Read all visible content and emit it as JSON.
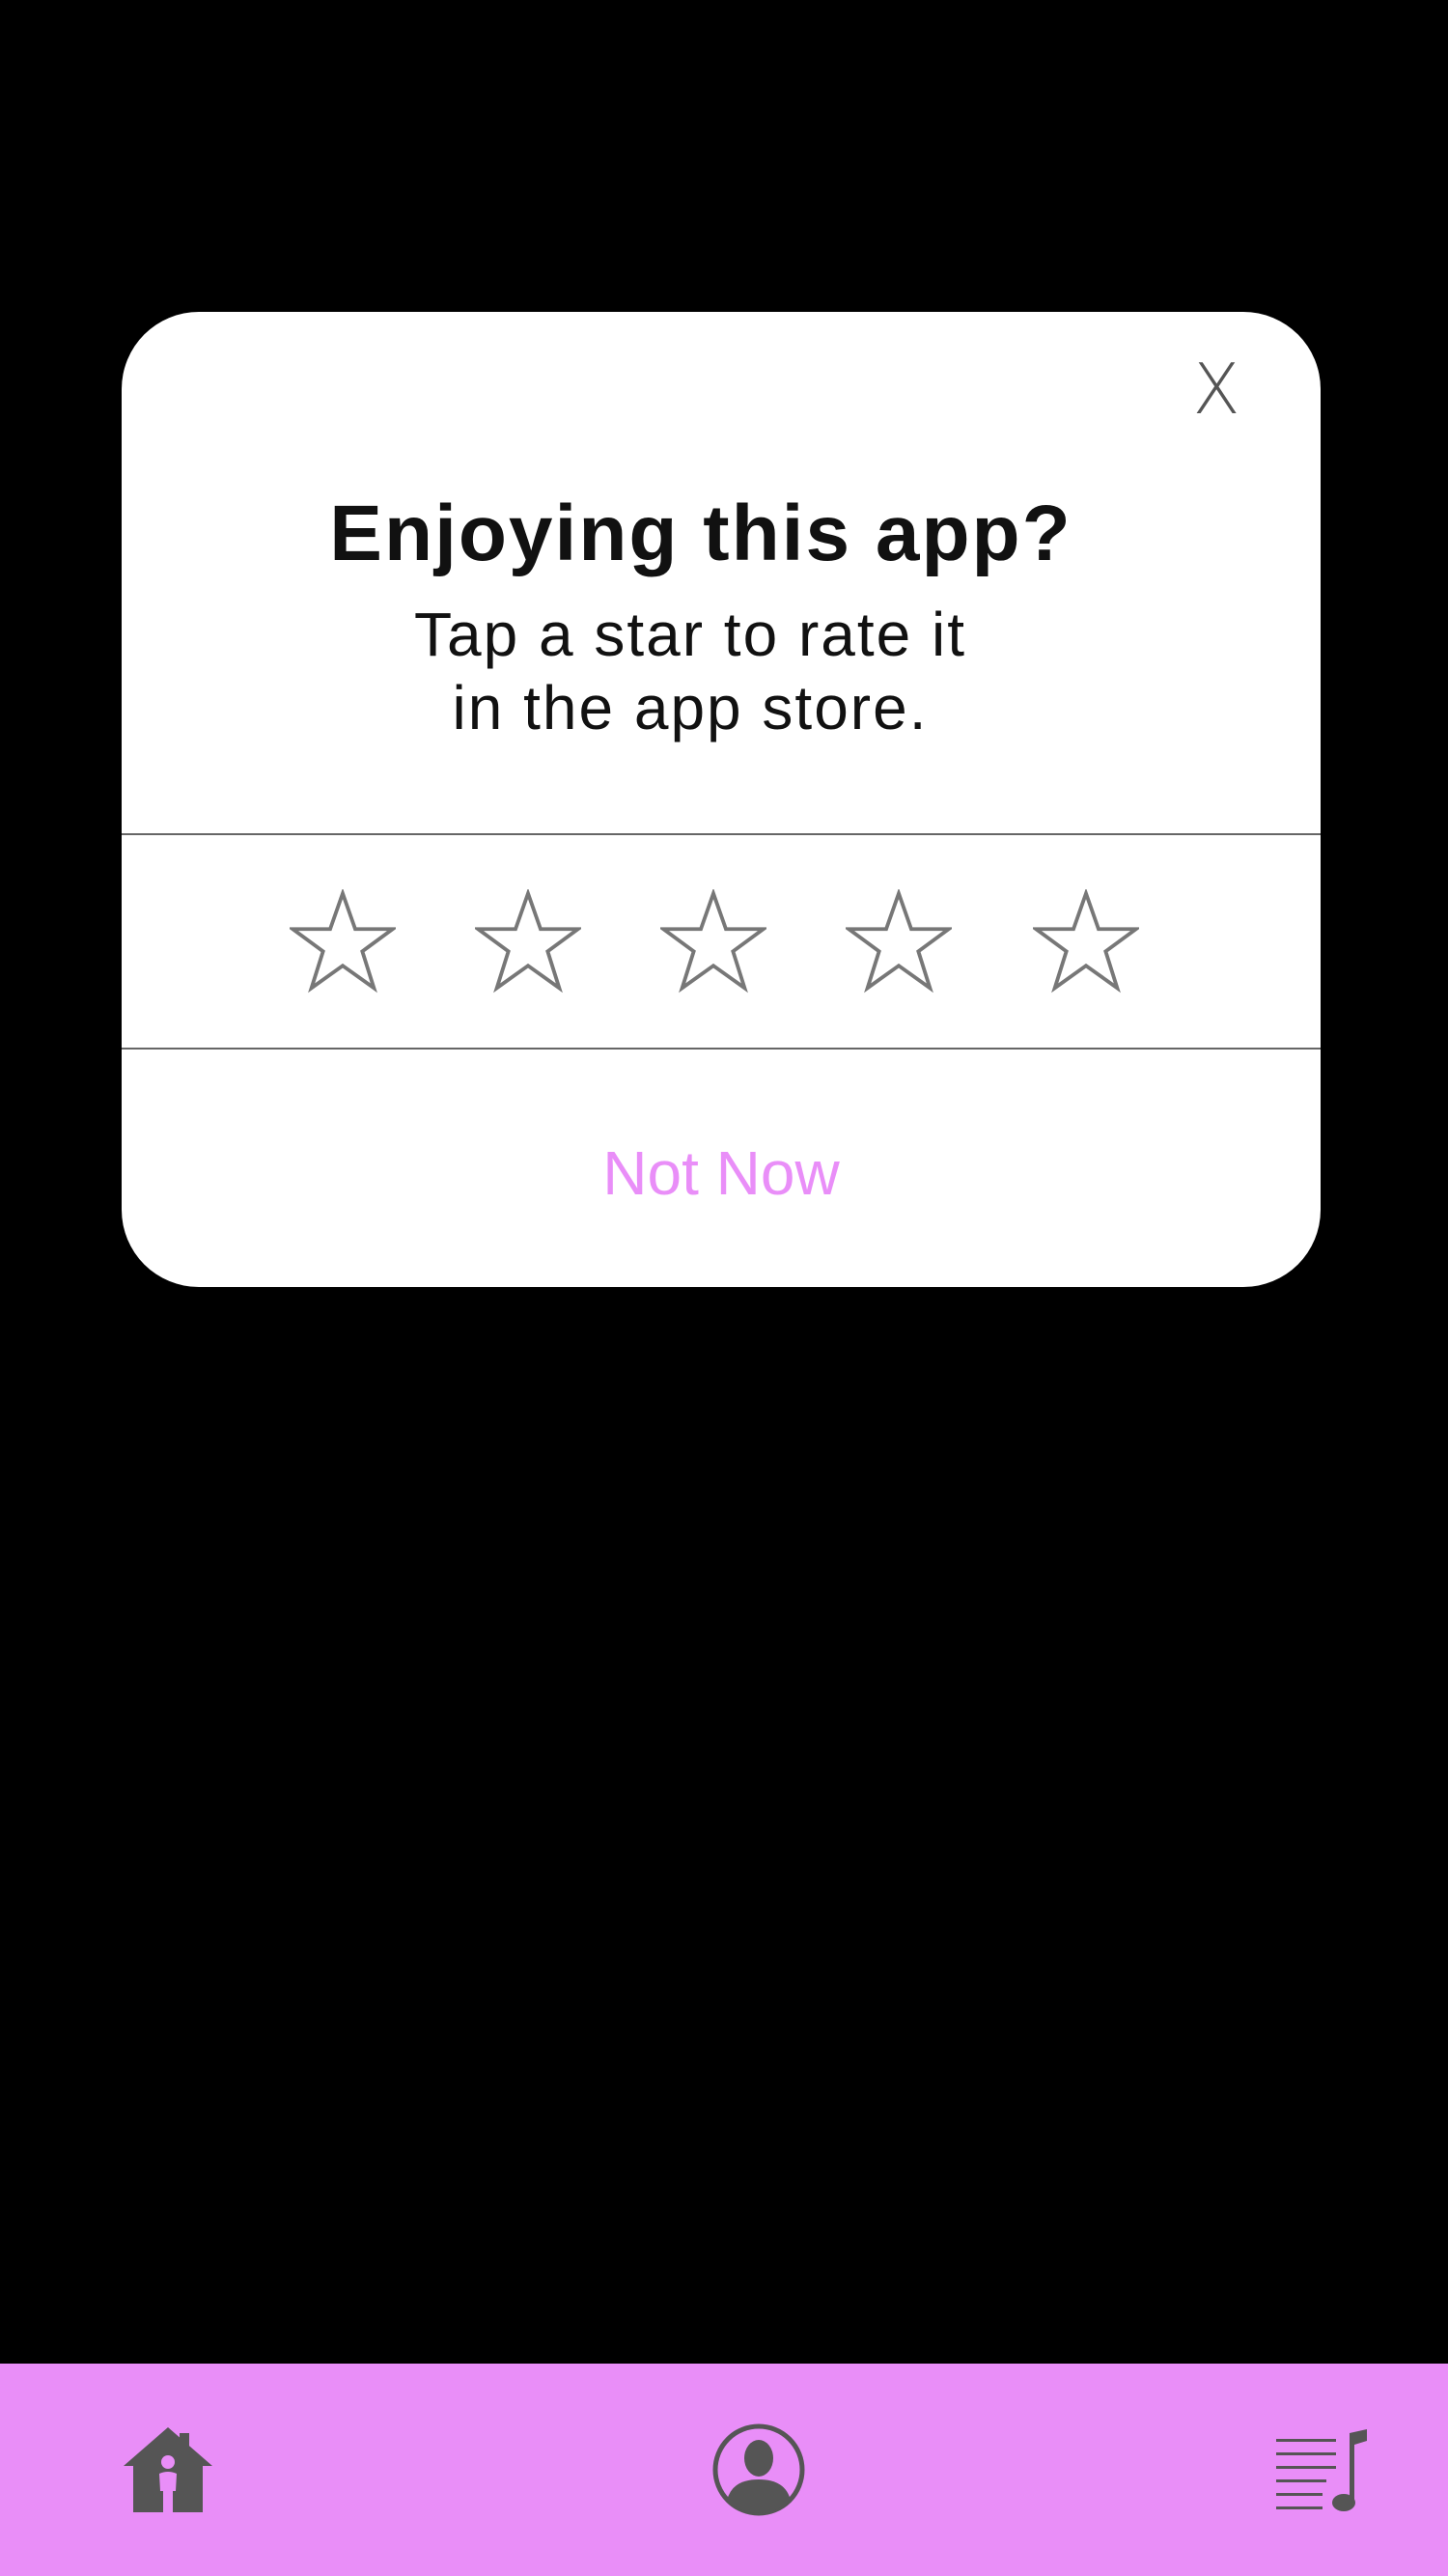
{
  "dialog": {
    "close_label": "X",
    "title": "Enjoying this app?",
    "subtitle_line1": "Tap a star to rate it",
    "subtitle_line2": "in the app store.",
    "stars": [
      {
        "icon": "star-outline-icon"
      },
      {
        "icon": "star-outline-icon"
      },
      {
        "icon": "star-outline-icon"
      },
      {
        "icon": "star-outline-icon"
      },
      {
        "icon": "star-outline-icon"
      }
    ],
    "not_now_label": "Not Now"
  },
  "tabbar": {
    "items": [
      {
        "icon": "home-icon"
      },
      {
        "icon": "profile-icon"
      },
      {
        "icon": "playlist-icon"
      }
    ]
  },
  "colors": {
    "background": "#000000",
    "accent": "#e98ef8",
    "icon_gray": "#555555",
    "star_stroke": "#777777"
  }
}
